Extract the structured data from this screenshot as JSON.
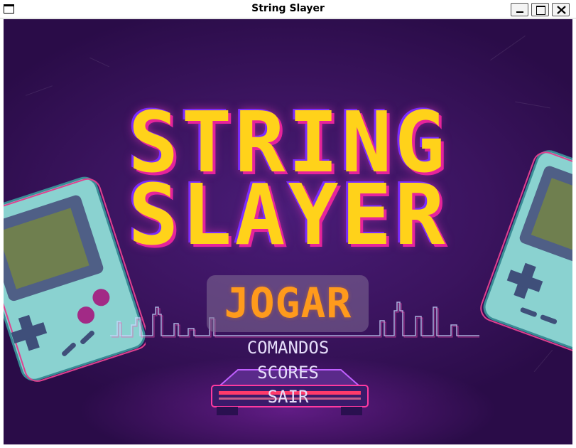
{
  "window": {
    "title": "String Slayer"
  },
  "game": {
    "logo_line1": "STRING",
    "logo_line2": "SLAYER",
    "menu": {
      "jogar": "JOGAR",
      "comandos": "COMANDOS",
      "scores": "SCORES",
      "sair": "SAIR"
    }
  },
  "colors": {
    "logo_fill": "#ffd21a",
    "logo_outline": "#e6249b",
    "selected_item": "#ff9a1c",
    "menu_item": "#e6defa",
    "background": "#3b145f"
  }
}
